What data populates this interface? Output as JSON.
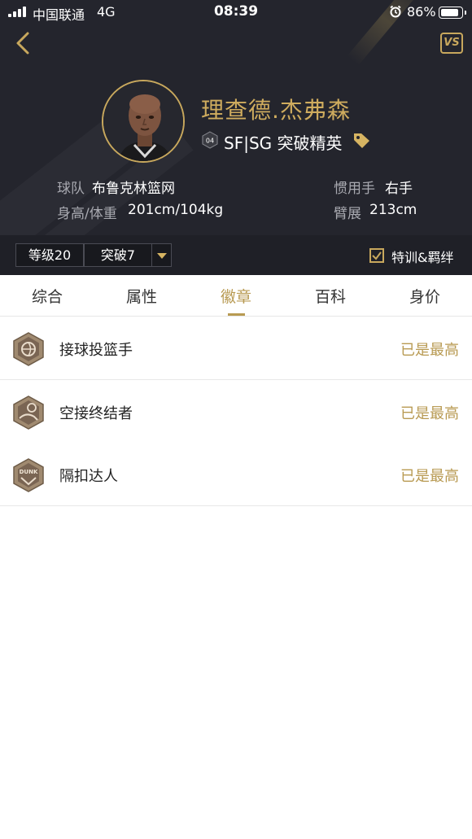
{
  "status_bar": {
    "carrier": "中国联通",
    "network": "4G",
    "time": "08:39",
    "battery": "86%"
  },
  "header": {
    "back_icon": "chevron-left-icon",
    "vs_label": "VS"
  },
  "player": {
    "name": "理查德.杰弗森",
    "jersey_number": "04",
    "position_line": "SF|SG 突破精英",
    "info": {
      "team_label": "球队",
      "team_value": "布鲁克林篮网",
      "hand_label": "惯用手",
      "hand_value": "右手",
      "size_label": "身高/体重",
      "size_value": "201cm/104kg",
      "wingspan_label": "臂展",
      "wingspan_value": "213cm"
    }
  },
  "level_bar": {
    "level": "等级20",
    "breakthrough": "突破7",
    "training_checked": true,
    "training_label": "特训&羁绊"
  },
  "tabs": [
    {
      "label": "综合",
      "active": false
    },
    {
      "label": "属性",
      "active": false
    },
    {
      "label": "徽章",
      "active": true
    },
    {
      "label": "百科",
      "active": false
    },
    {
      "label": "身价",
      "active": false
    }
  ],
  "badges": [
    {
      "name": "接球投篮手",
      "status": "已是最高",
      "icon": "catch-shoot-badge-icon"
    },
    {
      "name": "空接终结者",
      "status": "已是最高",
      "icon": "alley-oop-badge-icon"
    },
    {
      "name": "隔扣达人",
      "status": "已是最高",
      "icon": "dunk-badge-icon",
      "icon_text": "DUNK"
    }
  ],
  "colors": {
    "gold": "#c8a85d",
    "header_bg": "#24252d",
    "status_gold": "#b89a52"
  }
}
